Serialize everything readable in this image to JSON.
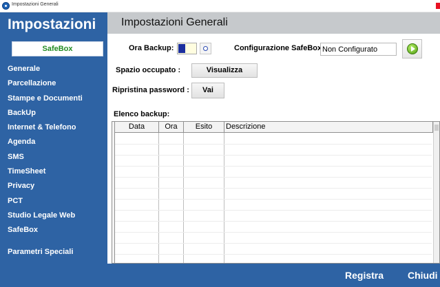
{
  "window": {
    "title": "Impostazioni Generali"
  },
  "sidebar": {
    "app_title": "Impostazioni",
    "active_section": "SafeBox",
    "items": [
      {
        "label": "Generale"
      },
      {
        "label": "Parcellazione"
      },
      {
        "label": "Stampe e Documenti"
      },
      {
        "label": "BackUp"
      },
      {
        "label": "Internet & Telefono"
      },
      {
        "label": "Agenda"
      },
      {
        "label": "SMS"
      },
      {
        "label": "TimeSheet"
      },
      {
        "label": "Privacy"
      },
      {
        "label": "PCT"
      },
      {
        "label": "Studio Legale Web"
      },
      {
        "label": "SafeBox"
      },
      {
        "label": "Parametri Speciali"
      }
    ]
  },
  "header": {
    "title": "Impostazioni Generali"
  },
  "form": {
    "ora_backup_label": "Ora Backup:",
    "ora_backup_value": "",
    "config_label": "Configurazione SafeBox:",
    "config_value": "Non Configurato",
    "spazio_label": "Spazio occupato :",
    "visualizza_label": "Visualizza",
    "ripristina_label": "Ripristina password :",
    "vai_label": "Vai",
    "elenco_label": "Elenco backup:"
  },
  "table": {
    "columns": [
      "Data",
      "Ora",
      "Esito",
      "Descrizione"
    ],
    "rows": []
  },
  "footer": {
    "registra_label": "Registra",
    "chiudi_label": "Chiudi"
  },
  "colors": {
    "sidebar_bg": "#2e63a4",
    "active_text": "#228b22",
    "header_bg": "#c6c9cc"
  }
}
